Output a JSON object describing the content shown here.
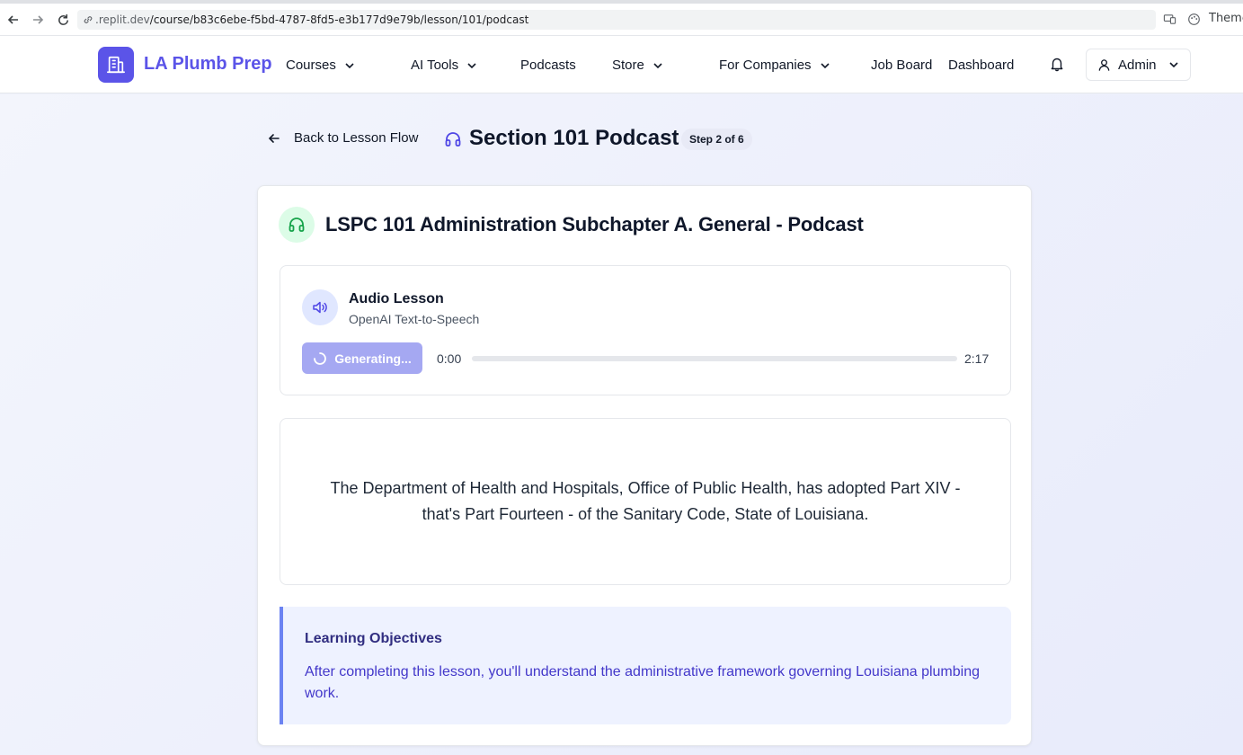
{
  "browser": {
    "url_host": ".replit.dev",
    "url_path": "/course/b83c6ebe-f5bd-4787-8fd5-e3b177d9e79b/lesson/101/podcast",
    "theme_label": "Theme"
  },
  "header": {
    "brand": "LA Plumb Prep",
    "nav": {
      "courses": "Courses",
      "ai_tools": "AI Tools",
      "podcasts": "Podcasts",
      "store": "Store",
      "for_companies": "For Companies",
      "job_board": "Job Board",
      "dashboard": "Dashboard"
    },
    "user_label": "Admin"
  },
  "page": {
    "back_label": "Back to Lesson Flow",
    "title": "Section 101 Podcast",
    "step_badge": "Step 2 of 6"
  },
  "card": {
    "title": "LSPC 101 Administration Subchapter A. General - Podcast",
    "audio": {
      "title": "Audio Lesson",
      "subtitle": "OpenAI Text-to-Speech",
      "button_label": "Generating...",
      "current_time": "0:00",
      "total_time": "2:17",
      "progress_fraction": 0
    },
    "transcript": "The Department of Health and Hospitals, Office of Public Health, has adopted Part XIV - that's Part Fourteen - of the Sanitary Code, State of Louisiana.",
    "objectives": {
      "title": "Learning Objectives",
      "text": "After completing this lesson, you'll understand the administrative framework governing Louisiana plumbing work."
    }
  },
  "colors": {
    "brand": "#5b54e8",
    "button_disabled": "#a5a8f2",
    "objective_accent": "#6b83f2",
    "podcast_icon_bg": "#dcfce7"
  }
}
